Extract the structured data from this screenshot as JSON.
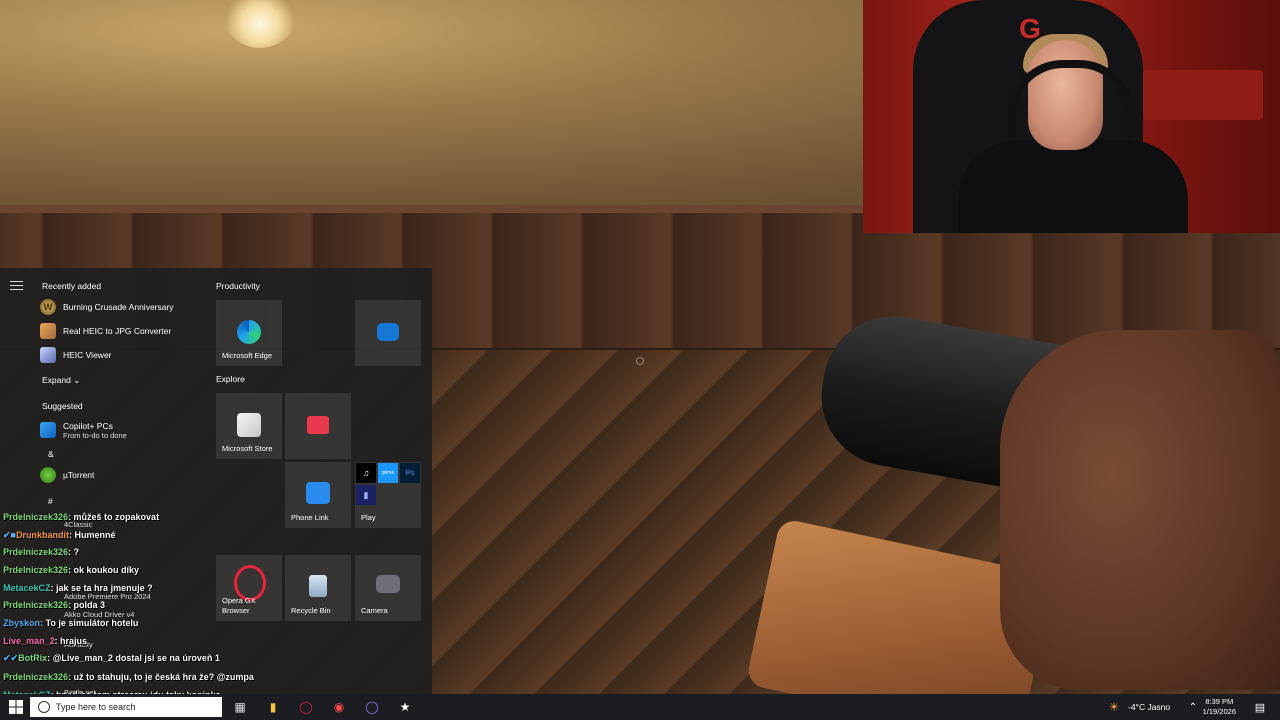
{
  "start_menu": {
    "recently_added_heading": "Recently added",
    "recent_apps": [
      "Burning Crusade Anniversary",
      "Real HEIC to JPG Converter",
      "HEIC Viewer"
    ],
    "expand_label": "Expand",
    "suggested_heading": "Suggested",
    "suggested_title": "Copilot+ PCs",
    "suggested_subtitle": "From to-do to done",
    "letter_amp": "&",
    "utorrent_label": "µTorrent",
    "letter_hash": "#",
    "hidden_items": [
      "4Classic",
      "Adobe Premiere Pro 2024",
      "Akko Cloud Driver v4",
      "Audacity",
      "Battle.net"
    ],
    "productivity_heading": "Productivity",
    "explore_heading": "Explore",
    "tiles": {
      "edge": "Microsoft Edge",
      "store": "Microsoft Store",
      "phone_link": "Phone Link",
      "play": "Play",
      "opera_line1": "Opera GX",
      "opera_line2": "Browser",
      "recycle_bin": "Recycle Bin",
      "camera": "Camera"
    }
  },
  "chat": [
    {
      "user": "Prdelniczek326",
      "text": "můžeš to zopakovat",
      "user_color": "#7fe07a"
    },
    {
      "user": "Drunkbandit",
      "text": "Humenné",
      "user_color": "#4fb4ff"
    },
    {
      "user": "Prdelniczek326",
      "text": "?",
      "user_color": "#7fe07a"
    },
    {
      "user": "Prdelniczek326",
      "text": "ok koukou díky",
      "user_color": "#7fe07a"
    },
    {
      "user": "MetacekCZ",
      "text": "jak se ta hra jmenuje ?",
      "user_color": "#2fd0c0"
    },
    {
      "user": "Prdelniczek326",
      "text": "polda 3",
      "user_color": "#7fe07a"
    },
    {
      "user": "Zbyskon",
      "text": "To je simulátor hotelu",
      "user_color": "#4fb4ff"
    },
    {
      "user": "Live_man_2",
      "text": "hrajus",
      "user_color": "#ff6bb0"
    },
    {
      "user": "BotRix",
      "text": "@Live_man_2 dostal jsi se na úroveň 1",
      "user_color": "#7fe07a"
    },
    {
      "user": "Prdelniczek326",
      "text": "už to stahuju, to je česká hra že? @zumpa",
      "user_color": "#7fe07a"
    },
    {
      "user": "MetacekCZ",
      "text": "hned po tom streamu jdu taky koninka",
      "user_color": "#2fd0c0"
    }
  ],
  "taskbar": {
    "search_placeholder": "Type here to search",
    "weather": "-4°C  Jasno",
    "time": "8:39 PM",
    "date": "1/19/2026"
  },
  "colors": {
    "start_bg": "#202020",
    "taskbar_bg": "#1b1d22",
    "webcam_red": "#b02a1f"
  }
}
